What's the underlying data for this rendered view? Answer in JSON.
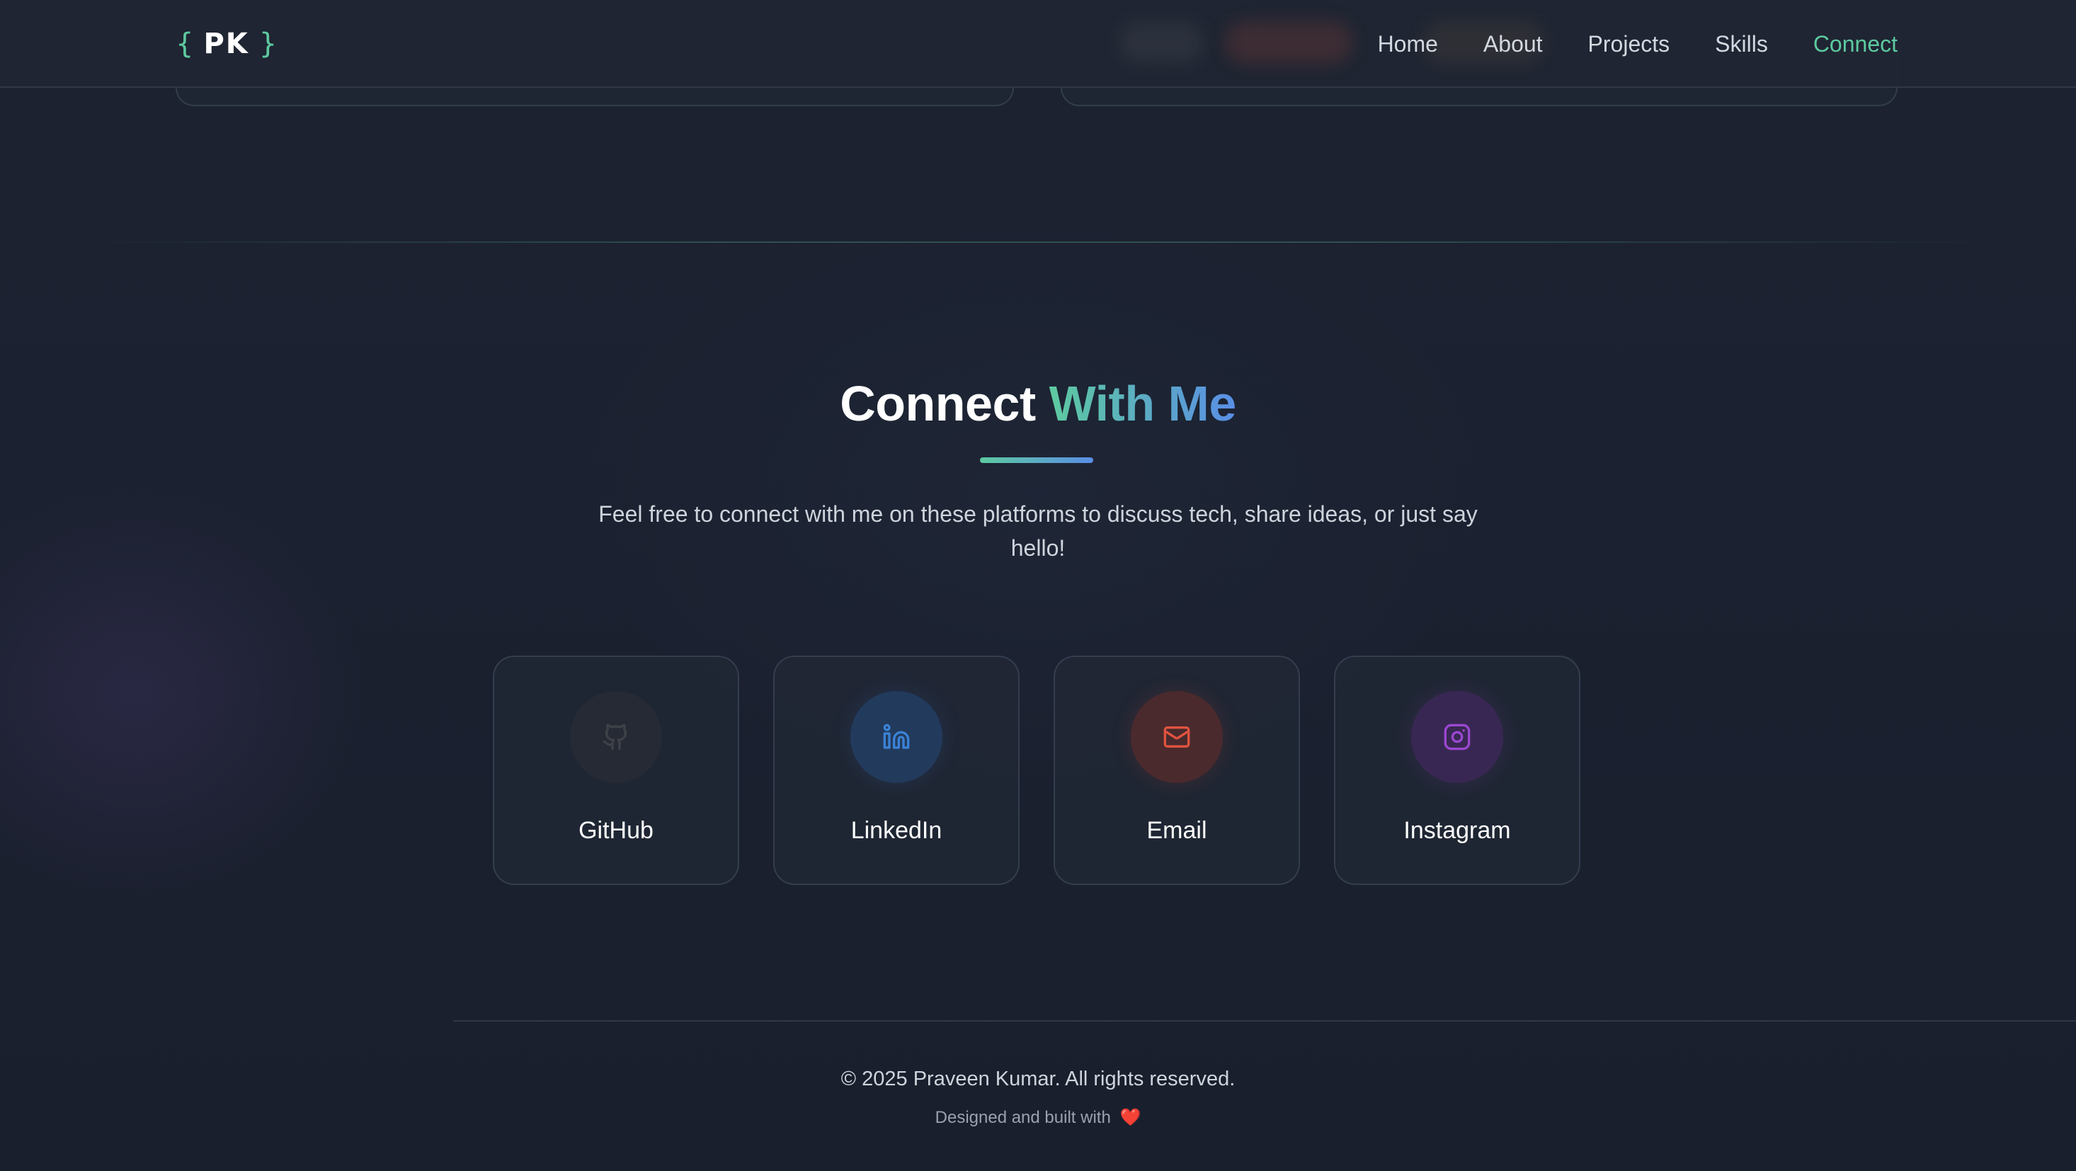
{
  "header": {
    "logo": {
      "open_brace": "{",
      "initials": "PK",
      "close_brace": "}"
    },
    "nav": [
      {
        "label": "Home",
        "active": false
      },
      {
        "label": "About",
        "active": false
      },
      {
        "label": "Projects",
        "active": false
      },
      {
        "label": "Skills",
        "active": false
      },
      {
        "label": "Connect",
        "active": true
      }
    ]
  },
  "connect": {
    "title_plain": "Connect",
    "title_highlight": "With Me",
    "subtitle": "Feel free to connect with me on these platforms to discuss tech, share ideas, or just say hello!",
    "cards": [
      {
        "label": "GitHub",
        "icon": "github-icon",
        "color": "#3f4148"
      },
      {
        "label": "LinkedIn",
        "icon": "linkedin-icon",
        "color": "#3b82d6"
      },
      {
        "label": "Email",
        "icon": "mail-icon",
        "color": "#e0533f"
      },
      {
        "label": "Instagram",
        "icon": "instagram-icon",
        "color": "#9a48d0"
      }
    ]
  },
  "footer": {
    "copyright": "© 2025 Praveen Kumar. All rights reserved.",
    "built_with": "Designed and built with",
    "heart": "❤️"
  },
  "colors": {
    "accent_green": "#5dcaa0",
    "accent_blue": "#5a8ee6",
    "background": "#1b2130"
  }
}
